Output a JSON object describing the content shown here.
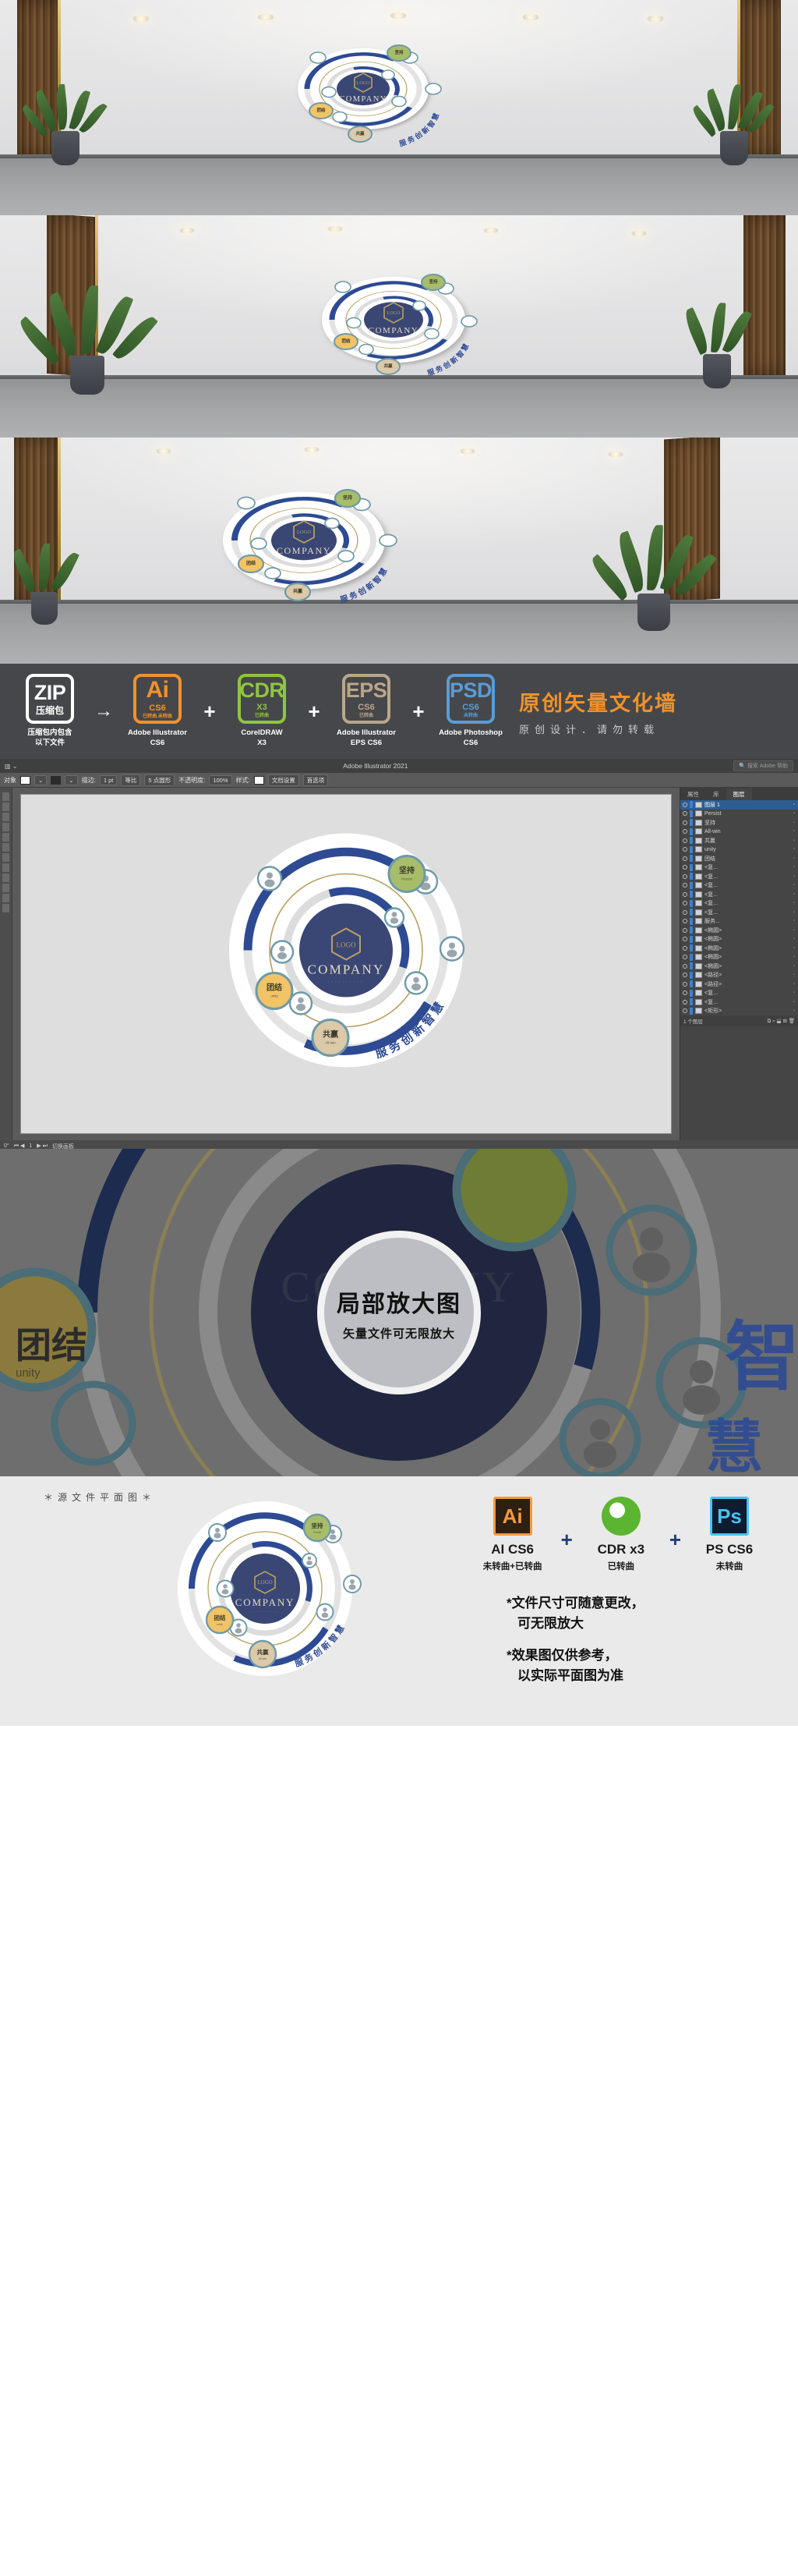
{
  "wall_graphic": {
    "center_logo": "LOGO",
    "center_company": "COMPANY",
    "center_company_sub": "···········",
    "arc_text": "服务创新智慧",
    "arc_text_chars": [
      "服",
      "务",
      "创",
      "新",
      "智",
      "慧"
    ],
    "badges": [
      {
        "cn": "坚持",
        "en": "Persist",
        "color": "#a8bd69"
      },
      {
        "cn": "团结",
        "en": "unity",
        "color": "#f2c466"
      },
      {
        "cn": "共赢",
        "en": "All-win",
        "color": "#dcc9a8"
      }
    ],
    "avatar_icon": "person-icon",
    "colors": {
      "deep_blue": "#3a4775",
      "ring_blue": "#2d4a93",
      "teal": "#6e9aa8",
      "gold": "#b99f62",
      "light_gray": "#d8d8d8"
    }
  },
  "software_strip": {
    "items": [
      {
        "abbr": "ZIP",
        "version": "压缩包",
        "note": "",
        "caption": "压缩包内包含\n以下文件",
        "color": "#ffffff"
      },
      {
        "abbr": "Ai",
        "version": "CS6",
        "note": "已转曲.未转曲",
        "caption": "Adobe Illustrator\nCS6",
        "color": "#f0922b"
      },
      {
        "abbr": "CDR",
        "version": "X3",
        "note": "已转曲",
        "caption": "CorelDRAW\nX3",
        "color": "#8dc63f"
      },
      {
        "abbr": "EPS",
        "version": "CS6",
        "note": "已转曲",
        "caption": "Adobe Illustrator\nEPS CS6",
        "color": "#b9a78a"
      },
      {
        "abbr": "PSD",
        "version": "CS6",
        "note": "未转曲",
        "caption": "Adobe Photoshop\nCS6",
        "color": "#5b9bd5"
      }
    ],
    "separators": [
      "→",
      "+",
      "+",
      "+"
    ],
    "title": "原创矢量文化墙",
    "subtitle": "原创设计．请勿转载",
    "title_color": "#f0922b",
    "bg_color": "#46474a"
  },
  "illustrator": {
    "app_title": "Adobe Illustrator 2021",
    "search_placeholder": "搜索 Adobe 帮助",
    "control_bar": {
      "object_label": "对象",
      "stroke_label": "描边:",
      "stroke_weight": "1 pt",
      "stroke_profile": "等比",
      "brush": "5 点圆形",
      "opacity_label": "不透明度:",
      "opacity_value": "100%",
      "style_label": "样式:",
      "doc_setup": "文档设置",
      "preferences": "首选项"
    },
    "panels": {
      "tabs": [
        "属性",
        "库",
        "图层"
      ],
      "active_tab": "图层"
    },
    "layers": [
      {
        "name": "图层 1",
        "selected": true
      },
      {
        "name": "Persist",
        "selected": false
      },
      {
        "name": "坚持",
        "selected": false
      },
      {
        "name": "All-win",
        "selected": false
      },
      {
        "name": "共赢",
        "selected": false
      },
      {
        "name": "unity",
        "selected": false
      },
      {
        "name": "团结",
        "selected": false
      },
      {
        "name": "<复...",
        "selected": false
      },
      {
        "name": "<复...",
        "selected": false
      },
      {
        "name": "<复...",
        "selected": false
      },
      {
        "name": "<复...",
        "selected": false
      },
      {
        "name": "<复...",
        "selected": false
      },
      {
        "name": "<复...",
        "selected": false
      },
      {
        "name": "服务...",
        "selected": false
      },
      {
        "name": "<椭圆>",
        "selected": false
      },
      {
        "name": "<椭圆>",
        "selected": false
      },
      {
        "name": "<椭圆>",
        "selected": false
      },
      {
        "name": "<椭圆>",
        "selected": false
      },
      {
        "name": "<椭圆>",
        "selected": false
      },
      {
        "name": "<路径>",
        "selected": false
      },
      {
        "name": "<路径>",
        "selected": false
      },
      {
        "name": "<复...",
        "selected": false
      },
      {
        "name": "<复...",
        "selected": false
      },
      {
        "name": "<矩形>",
        "selected": false
      }
    ],
    "layers_footer_count": "1 个图层",
    "status_bar": {
      "rotation": "0°",
      "page": "1",
      "artboard_nav": "切换画板"
    }
  },
  "zoom_section": {
    "title": "局部放大图",
    "subtitle": "矢量文件可无限放大",
    "bg_color": "#6e6e6e"
  },
  "footer": {
    "plan_label": "＊源文件平面图＊",
    "apps": [
      {
        "icon": "ai-icon",
        "abbr": "Ai",
        "name": "AI CS6",
        "sub": "未转曲+已转曲",
        "color": "#f79a3d",
        "bg": "#2d1f12"
      },
      {
        "icon": "cdr-icon",
        "abbr": "",
        "name": "CDR x3",
        "sub": "已转曲",
        "color": "#5cb531",
        "bg": "#ffffff"
      },
      {
        "icon": "ps-icon",
        "abbr": "Ps",
        "name": "PS CS6",
        "sub": "未转曲",
        "color": "#46c3f3",
        "bg": "#0f1b2e"
      }
    ],
    "plus_signs": [
      "+",
      "+"
    ],
    "notes": [
      {
        "line1": "*文件尺寸可随意更改，",
        "line2": "可无限放大"
      },
      {
        "line1": "*效果图仅供参考，",
        "line2": "以实际平面图为准"
      }
    ]
  }
}
